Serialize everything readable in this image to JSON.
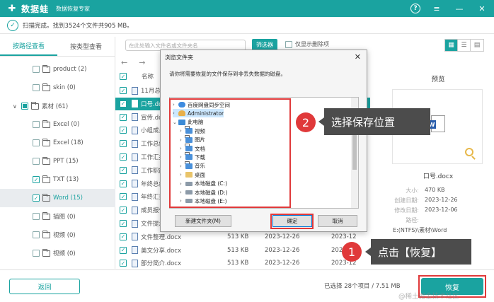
{
  "app": {
    "brand": "数据蛙",
    "subtitle": "数据恢复专家",
    "window_buttons": [
      "help-icon",
      "menu-icon",
      "minimize-icon",
      "close-icon"
    ]
  },
  "scan": {
    "status": "扫描完成。找到3524个文件共905 MB。"
  },
  "left_tabs": [
    "按路径查看",
    "按类型查看"
  ],
  "tree": [
    {
      "label": "product (2)",
      "checked": false
    },
    {
      "label": "skin (0)",
      "checked": false
    },
    {
      "label": "素材 (61)",
      "checked": "partial",
      "expanded": true
    },
    {
      "label": "Excel (0)",
      "checked": false
    },
    {
      "label": "Excel (18)",
      "checked": false
    },
    {
      "label": "PPT (15)",
      "checked": false
    },
    {
      "label": "TXT (13)",
      "checked": true
    },
    {
      "label": "Word (15)",
      "checked": true,
      "selected": true
    },
    {
      "label": "插图 (0)",
      "checked": false
    },
    {
      "label": "视频 (0)",
      "checked": false
    },
    {
      "label": "视频 (0)",
      "checked": false
    }
  ],
  "toolbar": {
    "search_placeholder": "在此处输入文件名或文件夹名",
    "filter_label": "筛选器",
    "deleted_only_label": "仅显示删除项"
  },
  "filelist": {
    "header_name": "名称",
    "rows": [
      {
        "name": "11月总结",
        "size": "",
        "date": "",
        "date2": "",
        "selected": false
      },
      {
        "name": "口号.docx",
        "size": "",
        "date": "",
        "date2": "",
        "selected": true
      },
      {
        "name": "宣传.docx",
        "size": "",
        "date": "",
        "date2": "",
        "selected": false
      },
      {
        "name": "小组成员",
        "size": "",
        "date": "",
        "date2": "",
        "selected": false
      },
      {
        "name": "工作总结",
        "size": "",
        "date": "",
        "date2": "",
        "selected": false
      },
      {
        "name": "工作汇报",
        "size": "",
        "date": "",
        "date2": "",
        "selected": false
      },
      {
        "name": "工作职能",
        "size": "",
        "date": "",
        "date2": "",
        "selected": false
      },
      {
        "name": "年终总结",
        "size": "",
        "date": "",
        "date2": "",
        "selected": false
      },
      {
        "name": "年终汇报",
        "size": "",
        "date": "",
        "date2": "",
        "selected": false
      },
      {
        "name": "成员报告",
        "size": "",
        "date": "",
        "date2": "",
        "selected": false
      },
      {
        "name": "文件提示",
        "size": "",
        "date": "",
        "date2": "",
        "selected": false
      },
      {
        "name": "文件整理.docx",
        "size": "513 KB",
        "date": "2023-12-26",
        "date2": "2023-12",
        "selected": false
      },
      {
        "name": "美文分享.docx",
        "size": "513 KB",
        "date": "2023-12-26",
        "date2": "2023-12",
        "selected": false
      },
      {
        "name": "部分简介.docx",
        "size": "513 KB",
        "date": "2023-12-26",
        "date2": "2023-12",
        "selected": false
      }
    ]
  },
  "preview": {
    "title": "预览",
    "filename": "口号.docx",
    "props": [
      {
        "label": "大小:",
        "value": "470 KB"
      },
      {
        "label": "创建日期:",
        "value": "2023-12-26"
      },
      {
        "label": "修改日期:",
        "value": "2023-12-06"
      },
      {
        "label": "路径:",
        "value": ""
      }
    ],
    "path": "E:(NTFS)\\素材\\Word"
  },
  "bottom": {
    "back_label": "返回",
    "selected_info": "已选择 28个项目 / 7.51 MB",
    "recover_label": "恢复",
    "watermark": "@稀土掘金技术社区"
  },
  "dialog": {
    "title": "浏览文件夹",
    "close": "✕",
    "message": "请你将需要恢复的文件保存到非丢失数据的磁盘。",
    "nodes": [
      {
        "label": "百度网盘同步空间",
        "icon": "cloud",
        "indent": 0,
        "arrow": ">"
      },
      {
        "label": "Administrator",
        "icon": "user",
        "indent": 0,
        "arrow": ">"
      },
      {
        "label": "此电脑",
        "icon": "pc",
        "indent": 0,
        "arrow": "v"
      },
      {
        "label": "视频",
        "icon": "folder",
        "indent": 1,
        "arrow": ">"
      },
      {
        "label": "图片",
        "icon": "folder",
        "indent": 1,
        "arrow": ">"
      },
      {
        "label": "文档",
        "icon": "folder",
        "indent": 1,
        "arrow": ">"
      },
      {
        "label": "下载",
        "icon": "folder",
        "indent": 1,
        "arrow": ">"
      },
      {
        "label": "音乐",
        "icon": "folder",
        "indent": 1,
        "arrow": ">"
      },
      {
        "label": "桌面",
        "icon": "fold-y",
        "indent": 1,
        "arrow": ">"
      },
      {
        "label": "本地磁盘 (C:)",
        "icon": "drive",
        "indent": 1,
        "arrow": ">"
      },
      {
        "label": "本地磁盘 (D:)",
        "icon": "drive",
        "indent": 1,
        "arrow": ">"
      },
      {
        "label": "本地磁盘 (E:)",
        "icon": "drive",
        "indent": 1,
        "arrow": ">"
      }
    ],
    "new_folder_label": "新建文件夹(M)",
    "ok_label": "确定",
    "cancel_label": "取消"
  },
  "callouts": {
    "step2_number": "2",
    "step2_text": "选择保存位置",
    "step1_number": "1",
    "step1_text": "点击【恢复】"
  },
  "colors": {
    "accent": "#1aa3a0",
    "highlight": "#e0393a",
    "callout_bg": "#4c4c4c"
  }
}
